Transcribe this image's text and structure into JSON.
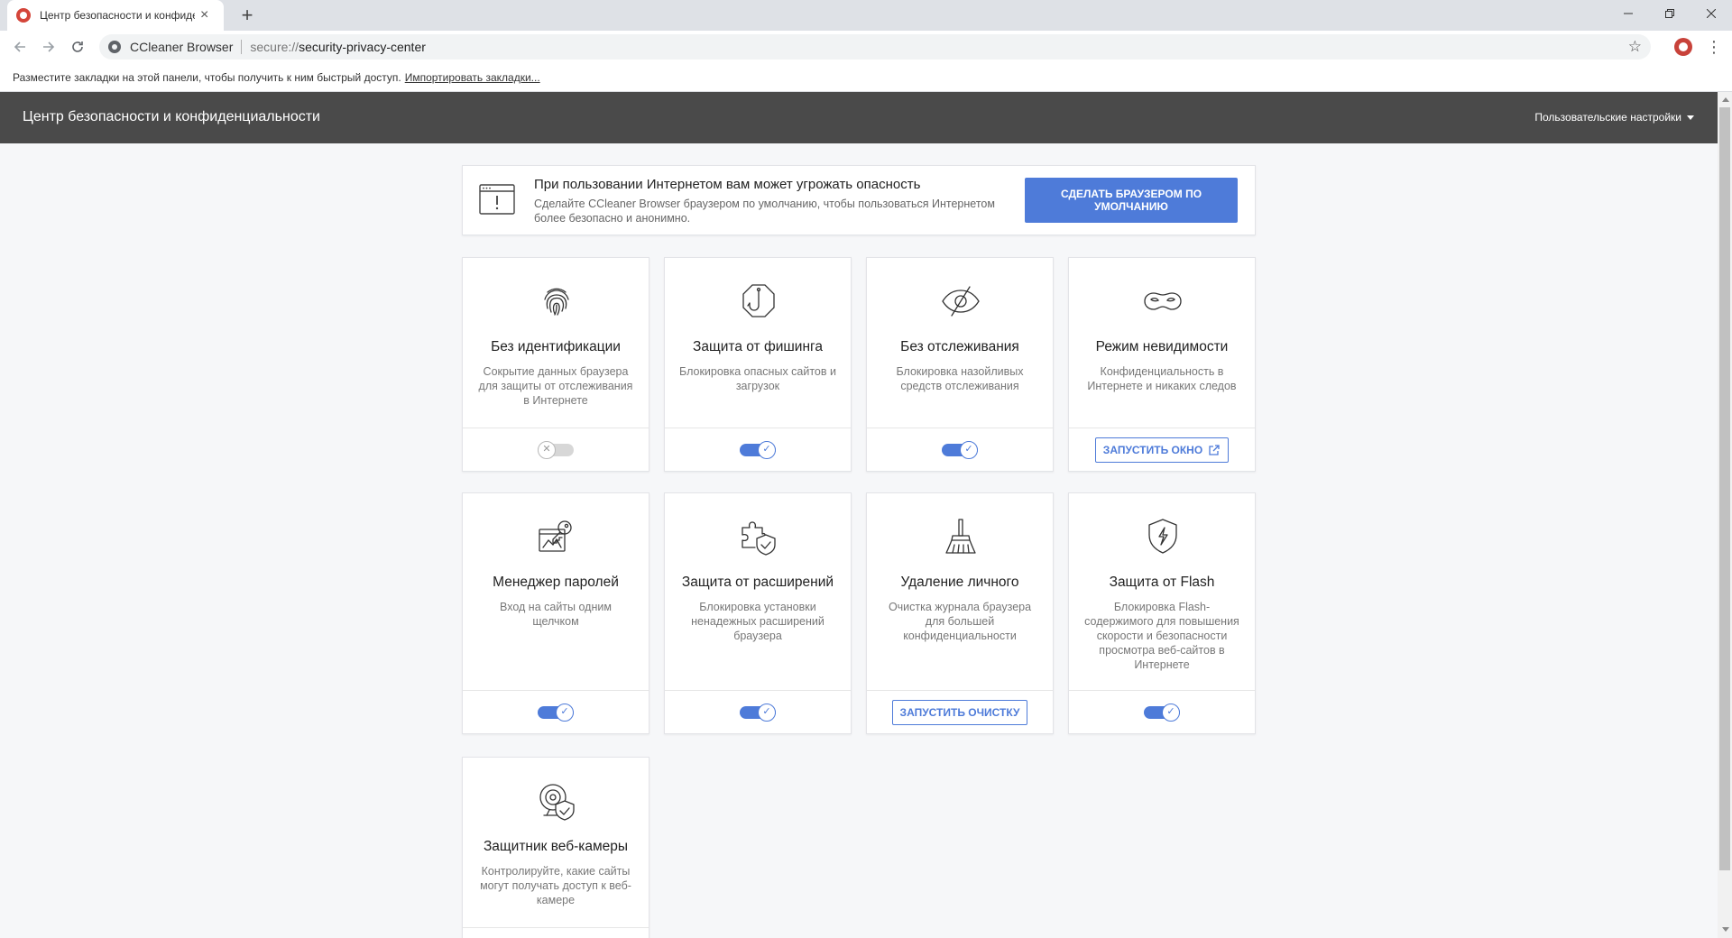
{
  "browser": {
    "tab_title": "Центр безопасности и конфиденциальности",
    "new_tab_symbol": "+",
    "omnibox": {
      "brand": "CCleaner Browser",
      "scheme": "secure://",
      "host": "security-privacy-center"
    },
    "bookmarks_bar": {
      "text": "Разместите закладки на этой панели, чтобы получить к ним быстрый доступ.",
      "link": "Импортировать закладки..."
    }
  },
  "header": {
    "title": "Центр безопасности и конфиденциальности",
    "user_settings": "Пользовательские настройки"
  },
  "banner": {
    "title": "При пользовании Интернетом вам может угрожать опасность",
    "text": "Сделайте CCleaner Browser браузером по умолчанию, чтобы пользоваться Интернетом более безопасно и анонимно.",
    "button": "Сделать браузером по умолчанию"
  },
  "cards": [
    {
      "icon": "fingerprint-icon",
      "title": "Без идентификации",
      "desc": "Сокрытие данных браузера для защиты от отслеживания в Интернете",
      "control": "toggle",
      "state": "off"
    },
    {
      "icon": "phishing-hook-icon",
      "title": "Защита от фишинга",
      "desc": "Блокировка опасных сайтов и загрузок",
      "control": "toggle",
      "state": "on"
    },
    {
      "icon": "eye-slash-icon",
      "title": "Без отслеживания",
      "desc": "Блокировка назойливых средств отслеживания",
      "control": "toggle",
      "state": "on"
    },
    {
      "icon": "mask-icon",
      "title": "Режим невидимости",
      "desc": "Конфиденциальность в Интернете и никаких следов",
      "control": "button",
      "button_label": "Запустить окно"
    },
    {
      "icon": "password-key-icon",
      "title": "Менеджер паролей",
      "desc": "Вход на сайты одним щелчком",
      "control": "toggle",
      "state": "on"
    },
    {
      "icon": "extension-shield-icon",
      "title": "Защита от расширений",
      "desc": "Блокировка установки ненадежных расширений браузера",
      "control": "toggle",
      "state": "on"
    },
    {
      "icon": "broom-icon",
      "title": "Удаление личного",
      "desc": "Очистка журнала браузера для большей конфиденциальности",
      "control": "button",
      "button_label": "Запустить очистку"
    },
    {
      "icon": "flash-shield-icon",
      "title": "Защита от Flash",
      "desc": "Блокировка Flash-содержимого для повышения скорости и безопасности просмотра веб-сайтов в Интернете",
      "control": "toggle",
      "state": "on"
    },
    {
      "icon": "webcam-shield-icon",
      "title": "Защитник веб-камеры",
      "desc": "Контролируйте, какие сайты могут получать доступ к веб-камере"
    }
  ],
  "colors": {
    "accent": "#4e7bd9",
    "header_bg": "#4a4a4a",
    "page_bg": "#f6f7f9"
  }
}
